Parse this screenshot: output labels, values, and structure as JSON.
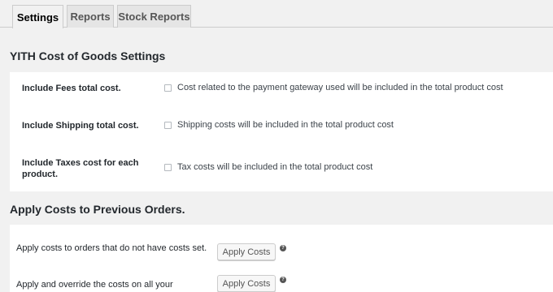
{
  "tabs": [
    {
      "label": "Settings",
      "active": true
    },
    {
      "label": "Reports",
      "active": false
    },
    {
      "label": "Stock Reports",
      "active": false
    }
  ],
  "settings_section": {
    "title": "YITH Cost of Goods Settings",
    "rows": [
      {
        "label": "Include Fees total cost.",
        "checkbox_text": "Cost related to the payment gateway used will be included in the total product cost",
        "checked": false
      },
      {
        "label": "Include Shipping total cost.",
        "checkbox_text": "Shipping costs will be included in the total product cost",
        "checked": false
      },
      {
        "label": "Include Taxes cost for each product.",
        "checkbox_text": "Tax costs will be included in the total product cost",
        "checked": false
      }
    ]
  },
  "apply_section": {
    "title": "Apply Costs to Previous Orders.",
    "rows": [
      {
        "label": "Apply costs to orders that do not have costs set.",
        "button_label": "Apply Costs",
        "help_icon": "question-mark-icon"
      },
      {
        "label": "Apply and override the costs on all your",
        "button_label": "Apply Costs",
        "help_icon": "question-mark-icon"
      }
    ]
  },
  "colors": {
    "background": "#f1f1f1",
    "panel": "#ffffff",
    "text": "#23282d",
    "border": "#cccccc"
  }
}
